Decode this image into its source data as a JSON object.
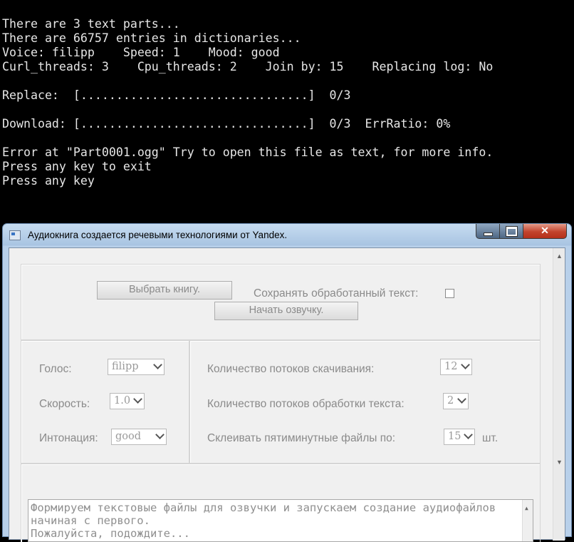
{
  "console": {
    "lines": [
      "There are 3 text parts...",
      "There are 66757 entries in dictionaries...",
      "Voice: filipp    Speed: 1    Mood: good",
      "Curl_threads: 3    Cpu_threads: 2    Join by: 15    Replacing log: No",
      "",
      "Replace:  [................................]  0/3",
      "",
      "Download: [................................]  0/3  ErrRatio: 0%",
      "",
      "Error at \"Part0001.ogg\" Try to open this file as text, for more info.",
      "Press any key to exit",
      "Press any key"
    ]
  },
  "window": {
    "title": "Аудиокнига создается речевыми технологиями от Yandex.",
    "close_glyph": "✕"
  },
  "controls": {
    "choose_book_label": "Выбрать книгу.",
    "save_text_label": "Сохранять обработанный текст:",
    "start_label": "Начать озвучку.",
    "voice_label": "Голос:",
    "voice_value": "filipp",
    "speed_label": "Скорость:",
    "speed_value": "1.0",
    "mood_label": "Интонация:",
    "mood_value": "good",
    "curl_label": "Количество потоков скачивания:",
    "curl_value": "12",
    "cpu_label": "Количество потоков обработки текста:",
    "cpu_value": "2",
    "join_label": "Склеивать пятиминутные файлы по:",
    "join_value": "15",
    "join_unit": "шт."
  },
  "log": {
    "text": "Формируем текстовые файлы для озвучки и запускаем создание аудиофайлов\nначиная с первого.\nПожалуйста, подождите..."
  },
  "icons": {
    "scroll_up": "▲",
    "scroll_down": "▼"
  }
}
